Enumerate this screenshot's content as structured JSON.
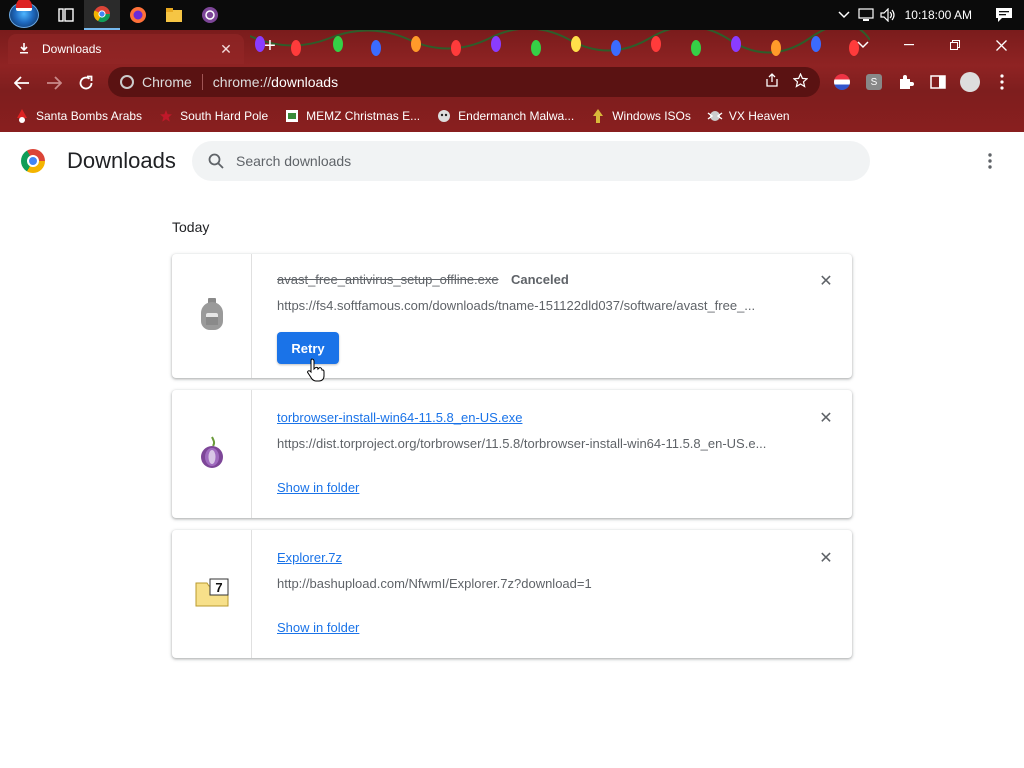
{
  "taskbar": {
    "apps": [
      "task-view-icon",
      "chrome-icon",
      "firefox-icon",
      "file-explorer-icon",
      "tor-icon"
    ],
    "clock": "10:18:00 AM"
  },
  "tab": {
    "title": "Downloads"
  },
  "omnibox": {
    "chip": "Chrome",
    "url_scheme": "chrome://",
    "url_host": "downloads"
  },
  "bookmarks": [
    {
      "label": "Santa Bombs Arabs",
      "icon": "santa-icon"
    },
    {
      "label": "South Hard Pole",
      "icon": "star-icon"
    },
    {
      "label": "MEMZ Christmas E...",
      "icon": "memz-icon"
    },
    {
      "label": "Endermanch Malwa...",
      "icon": "endermanch-icon"
    },
    {
      "label": "Windows ISOs",
      "icon": "windows-iso-icon"
    },
    {
      "label": "VX Heaven",
      "icon": "vx-heaven-icon"
    }
  ],
  "page": {
    "title": "Downloads",
    "search_placeholder": "Search downloads",
    "section": "Today"
  },
  "downloads": [
    {
      "file_name": "avast_free_antivirus_setup_offline.exe",
      "status": "Canceled",
      "url": "https://fs4.softfamous.com/downloads/tname-151122dld037/software/avast_free_...",
      "action": "Retry",
      "icon": "avast-bottle-icon"
    },
    {
      "file_name": "torbrowser-install-win64-11.5.8_en-US.exe",
      "url": "https://dist.torproject.org/torbrowser/11.5.8/torbrowser-install-win64-11.5.8_en-US.e...",
      "action": "Show in folder",
      "icon": "tor-onion-icon"
    },
    {
      "file_name": "Explorer.7z",
      "url": "http://bashupload.com/NfwmI/Explorer.7z?download=1",
      "action": "Show in folder",
      "icon": "7z-archive-icon"
    }
  ],
  "colors": {
    "accent": "#1a73e8",
    "titlebar": "#7a1c1c",
    "page_bg": "#ffffff"
  }
}
